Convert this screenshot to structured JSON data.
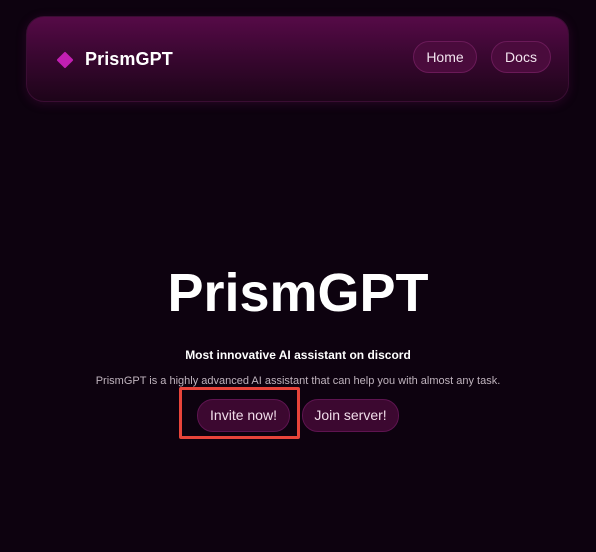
{
  "navbar": {
    "brand_name": "PrismGPT",
    "brand_icon": "diamond-icon",
    "links": [
      {
        "label": "Home"
      },
      {
        "label": "Docs"
      }
    ]
  },
  "hero": {
    "title": "PrismGPT",
    "tagline": "Most innovative AI assistant on discord",
    "description": "PrismGPT is a highly advanced AI assistant that can help you with almost any task.",
    "buttons": {
      "invite_label": "Invite now!",
      "join_label": "Join server!"
    }
  },
  "colors": {
    "background": "#0d020f",
    "accent": "#c21fb2",
    "button_bg": "#3c0830",
    "highlight": "#e8443a"
  }
}
